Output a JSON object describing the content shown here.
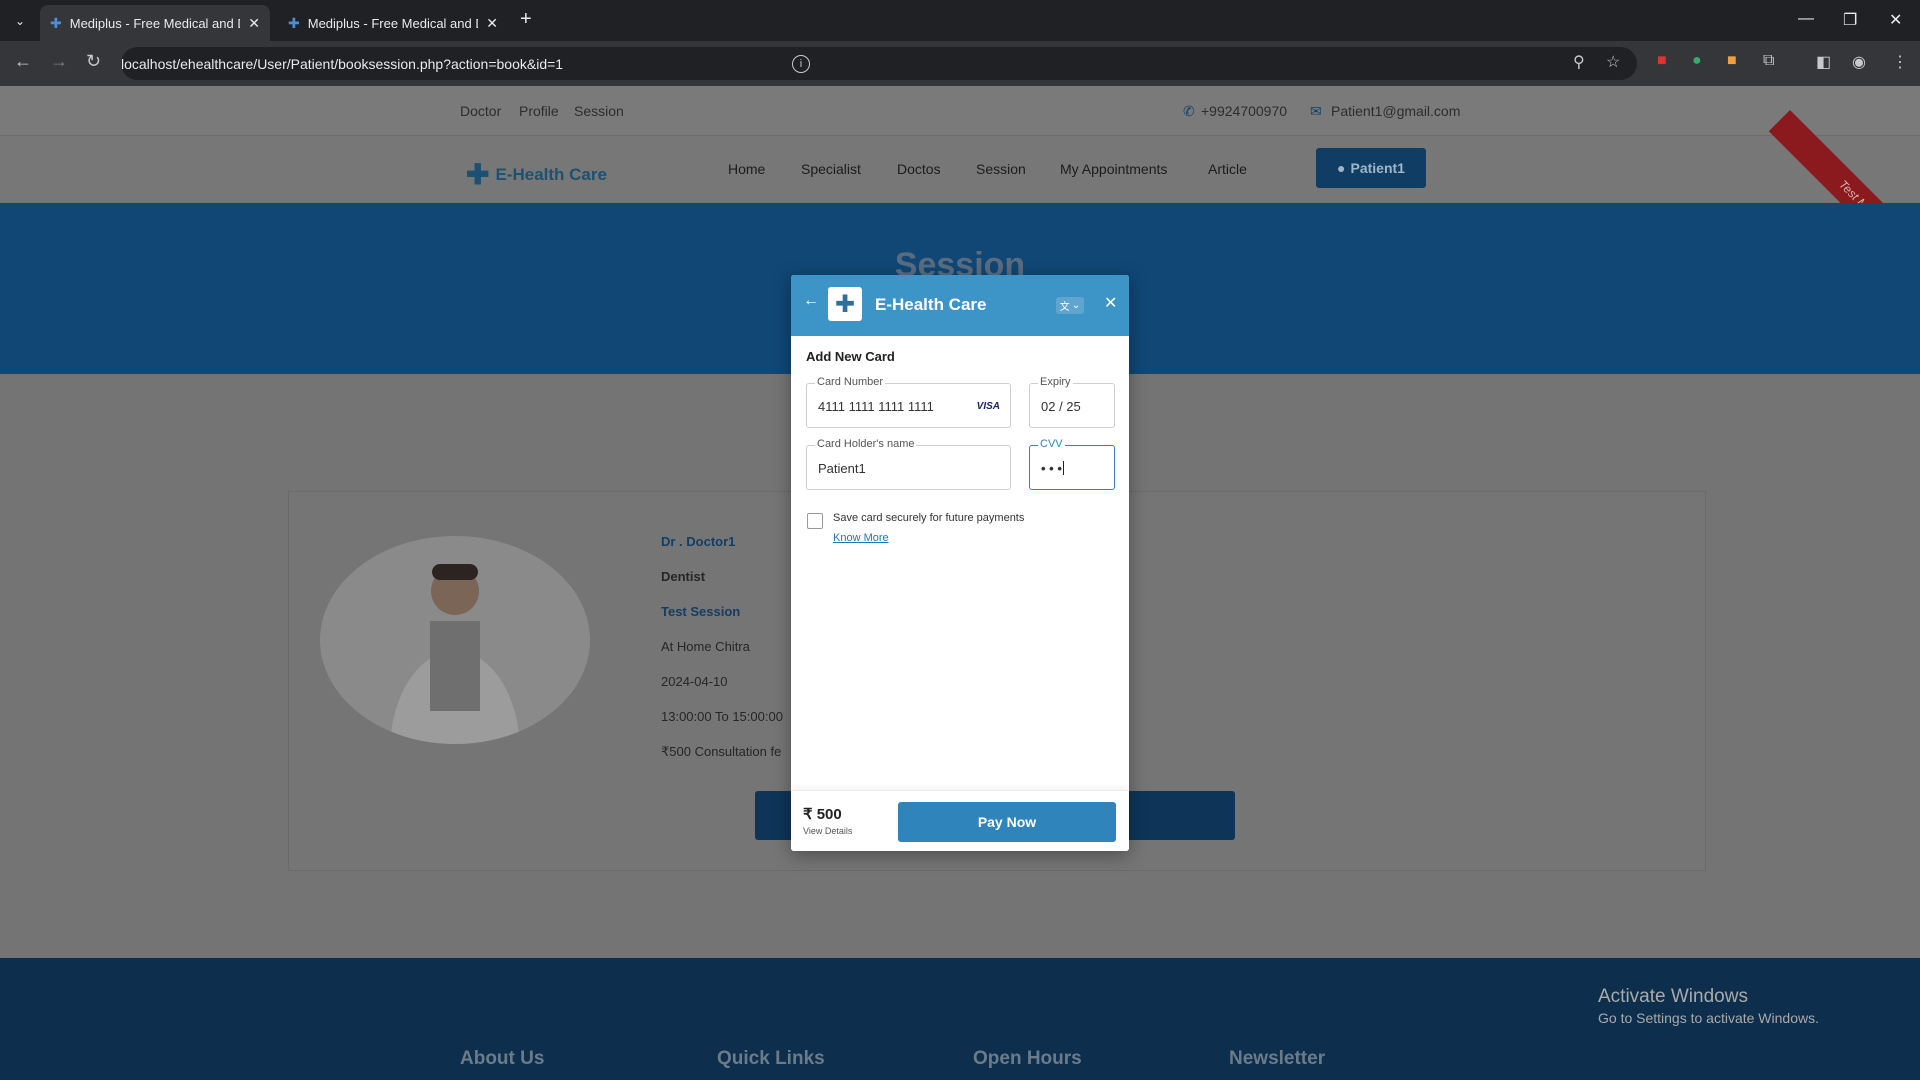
{
  "browser": {
    "tabs": [
      {
        "title": "Mediplus - Free Medical and D",
        "active": true
      },
      {
        "title": "Mediplus - Free Medical and D",
        "active": false
      }
    ],
    "url": "localhost/ehealthcare/User/Patient/booksession.php?action=book&id=1"
  },
  "site": {
    "top_links": [
      "Doctor",
      "Profile",
      "Session"
    ],
    "phone": "+9924700970",
    "email": "Patient1@gmail.com",
    "logo": "E-Health Care",
    "nav": [
      "Home",
      "Specialist",
      "Doctos",
      "Session",
      "My Appointments",
      "Article"
    ],
    "user_button": "Patient1",
    "ribbon": "Test Mode",
    "banner_title": "Session"
  },
  "doctor": {
    "name": "Dr . Doctor1",
    "speciality": "Dentist",
    "session": "Test Session",
    "location": "At Home Chitra",
    "date": "2024-04-10",
    "time": "13:00:00 To 15:00:00",
    "fee": "₹500 Consultation fe"
  },
  "footer": {
    "headings": [
      "About Us",
      "Quick Links",
      "Open Hours",
      "Newsletter"
    ],
    "activate_title": "Activate Windows",
    "activate_sub": "Go to Settings to activate Windows."
  },
  "modal": {
    "title": "E-Health Care",
    "lang": "文",
    "heading": "Add New Card",
    "card_number_label": "Card Number",
    "card_number": "4111 1111 1111 1111",
    "card_brand": "VISA",
    "expiry_label": "Expiry",
    "expiry": "02 / 25",
    "holder_label": "Card Holder's name",
    "holder": "Patient1",
    "cvv_label": "CVV",
    "cvv": "• • •",
    "save_text": "Save card securely for future payments",
    "know_more": "Know More",
    "amount": "₹ 500",
    "view_details": "View Details",
    "pay_button": "Pay Now"
  }
}
